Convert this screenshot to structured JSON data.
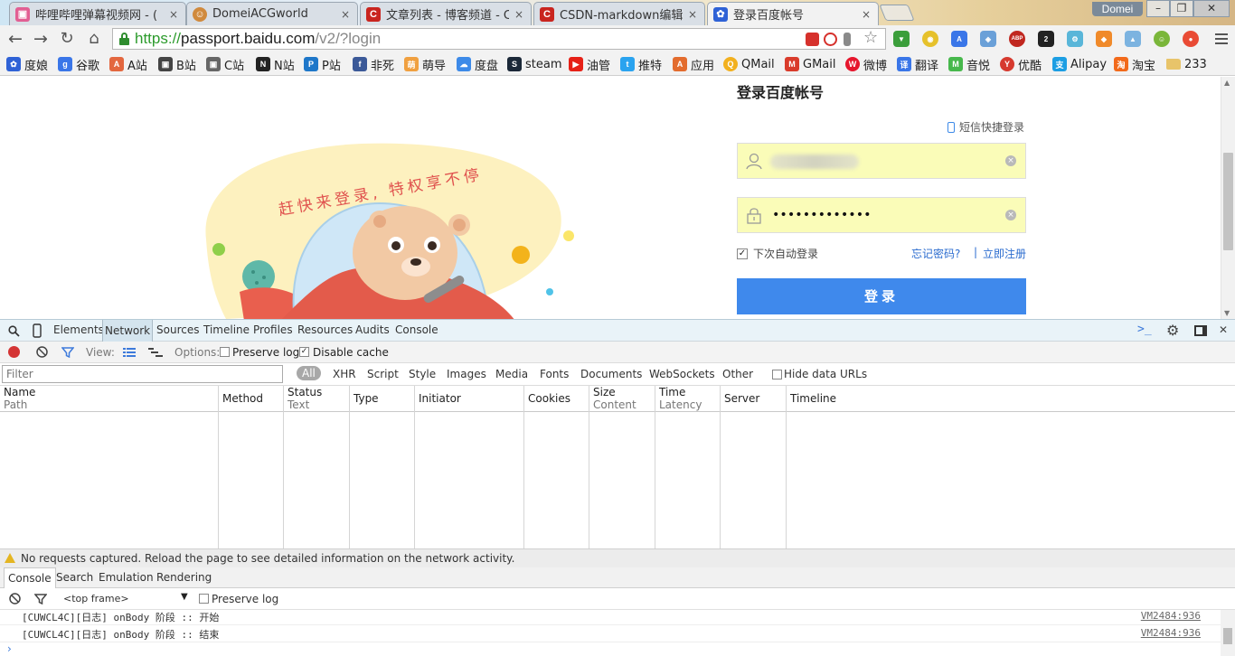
{
  "browser": {
    "profile_name": "Domei",
    "tabs": [
      {
        "title": "哔哩哔哩弹幕视频网 - (",
        "favicon_color": "#e25f93",
        "favicon_glyph": "tv-icon",
        "active": false
      },
      {
        "title": "DomeiACGworld",
        "favicon_color": "#d08a3d",
        "favicon_glyph": "avatar-icon",
        "active": false
      },
      {
        "title": "文章列表 - 博客频道 - CS",
        "favicon_color": "#c9251f",
        "favicon_glyph": "C",
        "active": false
      },
      {
        "title": "CSDN-markdown编辑器",
        "favicon_color": "#c9251f",
        "favicon_glyph": "C",
        "active": false
      },
      {
        "title": "登录百度帐号",
        "favicon_color": "#2f62d6",
        "favicon_glyph": "paw-icon",
        "active": true
      }
    ],
    "close_glyph": "×",
    "window_controls": [
      "–",
      "❐",
      "✕"
    ],
    "address": {
      "scheme": "https://",
      "host": "passport.baidu.com",
      "path": "/v2/?login"
    },
    "bookmarks": [
      {
        "label": "度娘",
        "color": "#2f62d6",
        "glyph": "🐾"
      },
      {
        "label": "谷歌",
        "color": "#3a76e8",
        "glyph": "g"
      },
      {
        "label": "A站",
        "color": "#e3673f",
        "glyph": "A"
      },
      {
        "label": "B站",
        "color": "#444444",
        "glyph": "B"
      },
      {
        "label": "C站",
        "color": "#444444",
        "glyph": "C"
      },
      {
        "label": "N站",
        "color": "#222222",
        "glyph": "N"
      },
      {
        "label": "P站",
        "color": "#1e77c9",
        "glyph": "P"
      },
      {
        "label": "非死",
        "color": "#3b5998",
        "glyph": "f"
      },
      {
        "label": "萌导",
        "color": "#f0a040",
        "glyph": "萌"
      },
      {
        "label": "度盘",
        "color": "#3d8ae8",
        "glyph": "☁"
      },
      {
        "label": "steam",
        "color": "#1b2838",
        "glyph": "S"
      },
      {
        "label": "油管",
        "color": "#e62117",
        "glyph": "▶"
      },
      {
        "label": "推特",
        "color": "#2aa3ef",
        "glyph": "t"
      },
      {
        "label": "应用",
        "color": "#e36c2e",
        "glyph": "A"
      },
      {
        "label": "QMail",
        "color": "#f2b01e",
        "glyph": "Q"
      },
      {
        "label": "GMail",
        "color": "#d93b2b",
        "glyph": "M"
      },
      {
        "label": "微博",
        "color": "#e6162d",
        "glyph": "W"
      },
      {
        "label": "翻译",
        "color": "#3a76e8",
        "glyph": "译"
      },
      {
        "label": "音悦",
        "color": "#47b84c",
        "glyph": "M"
      },
      {
        "label": "优酷",
        "color": "#d63a2f",
        "glyph": "Y"
      },
      {
        "label": "Alipay",
        "color": "#1c9ee3",
        "glyph": "支"
      },
      {
        "label": "淘宝",
        "color": "#f26a1b",
        "glyph": "淘"
      },
      {
        "label": "233",
        "color": "#e8c46a",
        "glyph": "",
        "folder": true
      }
    ]
  },
  "page": {
    "title": "登录百度帐号",
    "sms_login": "短信快捷登录",
    "username_field": {
      "value": "",
      "icon": "user-icon"
    },
    "password_field": {
      "value": "•••••••••••••",
      "icon": "lock-icon"
    },
    "clear_glyph": "×",
    "remember_label": "下次自动登录",
    "remember_checked": true,
    "forgot_label": "忘记密码?",
    "separator": "|",
    "register_label": "立即注册",
    "login_button": "登录",
    "banner_text": "赶快来登录, 特权享不停",
    "accent": "#3f89ec",
    "field_bg": "#fafcb8"
  },
  "devtools": {
    "panels": [
      "Elements",
      "Network",
      "Sources",
      "Timeline",
      "Profiles",
      "Resources",
      "Audits",
      "Console"
    ],
    "active_panel": "Network",
    "network": {
      "view_label": "View:",
      "options_label": "Options:",
      "preserve_log": "Preserve log",
      "disable_cache": "Disable cache",
      "preserve_checked": false,
      "disable_cache_checked": true,
      "filter_placeholder": "Filter",
      "types": [
        "All",
        "XHR",
        "Script",
        "Style",
        "Images",
        "Media",
        "Fonts",
        "Documents",
        "WebSockets",
        "Other"
      ],
      "hide_data_urls": "Hide data URLs",
      "columns": [
        {
          "title": "Name",
          "sub": "Path"
        },
        {
          "title": "Method",
          "sub": ""
        },
        {
          "title": "Status",
          "sub": "Text"
        },
        {
          "title": "Type",
          "sub": ""
        },
        {
          "title": "Initiator",
          "sub": ""
        },
        {
          "title": "Cookies",
          "sub": ""
        },
        {
          "title": "Size",
          "sub": "Content"
        },
        {
          "title": "Time",
          "sub": "Latency"
        },
        {
          "title": "Server",
          "sub": ""
        },
        {
          "title": "Timeline",
          "sub": ""
        }
      ],
      "empty_message": "No requests captured. Reload the page to see detailed information on the network activity."
    },
    "drawer_tabs": [
      "Console",
      "Search",
      "Emulation",
      "Rendering"
    ],
    "active_drawer_tab": "Console",
    "console": {
      "frame": "<top frame>",
      "preserve_log": "Preserve log",
      "lines": [
        {
          "text": "[CUWCL4C][日志] onBody 阶段 :: 开始",
          "source": "VM2484:936"
        },
        {
          "text": "[CUWCL4C][日志] onBody 阶段 :: 结束",
          "source": "VM2484:936"
        }
      ],
      "prompt": "›"
    }
  }
}
